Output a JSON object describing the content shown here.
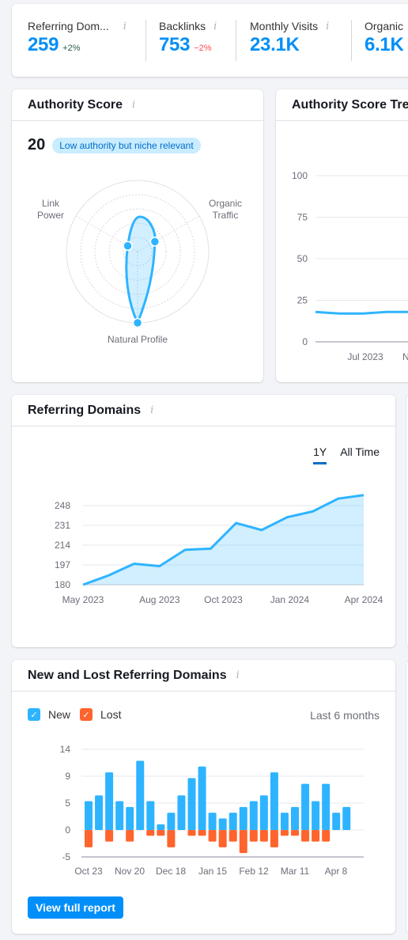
{
  "metrics": [
    {
      "label": "Referring Dom...",
      "value": "259",
      "delta": "+2%",
      "delta_type": "positive"
    },
    {
      "label": "Backlinks",
      "value": "753",
      "delta": "−2%",
      "delta_type": "negative"
    },
    {
      "label": "Monthly Visits",
      "value": "23.1K",
      "delta": "",
      "delta_type": ""
    },
    {
      "label": "Organic",
      "value": "6.1K",
      "delta": "",
      "delta_type": ""
    }
  ],
  "icons": {
    "info": "i"
  },
  "authority_score": {
    "title": "Authority Score",
    "score": "20",
    "badge": "Low authority but niche relevant",
    "radar": {
      "axes": [
        {
          "label_lines": [
            "Link",
            "Power"
          ],
          "value": 0.16
        },
        {
          "label_lines": [
            "Organic",
            "Traffic"
          ],
          "value": 0.28
        },
        {
          "label_lines": [
            "Natural Profile"
          ],
          "value": 1.0
        }
      ],
      "rings": 5
    }
  },
  "authority_trend": {
    "title": "Authority Score Trend",
    "yticks": [
      "100",
      "75",
      "50",
      "25",
      "0"
    ],
    "xticks": [
      "Jul 2023",
      "N"
    ],
    "values": [
      18,
      17,
      17,
      18,
      18,
      18
    ]
  },
  "referring_domains": {
    "title": "Referring Domains",
    "tabs": [
      {
        "label": "1Y",
        "active": true
      },
      {
        "label": "All Time",
        "active": false
      }
    ],
    "chart_data": {
      "type": "area",
      "x": [
        "May 2023",
        "Jun 2023",
        "Jul 2023",
        "Aug 2023",
        "Sep 2023",
        "Oct 2023",
        "Nov 2023",
        "Dec 2023",
        "Jan 2024",
        "Feb 2024",
        "Mar 2024",
        "Apr 2024"
      ],
      "values": [
        180,
        188,
        198,
        196,
        210,
        211,
        233,
        227,
        238,
        243,
        254,
        257
      ],
      "yticks": [
        180,
        197,
        214,
        231,
        248
      ],
      "xtick_labels": [
        "May 2023",
        "Aug 2023",
        "Oct 2023",
        "Jan 2024",
        "Apr 2024"
      ],
      "ylim": [
        180,
        260
      ],
      "color": "#2eb4ff"
    }
  },
  "new_lost": {
    "title": "New and Lost Referring Domains",
    "legend": [
      {
        "label": "New",
        "color": "#2eb4ff"
      },
      {
        "label": "Lost",
        "color": "#ff642d"
      }
    ],
    "period": "Last 6 months",
    "button": "View full report",
    "chart_data": {
      "type": "bar",
      "series": [
        {
          "name": "New",
          "values": [
            5,
            6,
            10,
            5,
            4,
            12,
            5,
            1,
            3,
            6,
            9,
            11,
            3,
            2,
            3,
            4,
            5,
            6,
            10,
            3,
            4,
            8,
            5,
            8,
            3,
            4
          ]
        },
        {
          "name": "Lost",
          "values": [
            -3,
            0,
            -2,
            0,
            -2,
            0,
            -1,
            -1,
            -3,
            0,
            -1,
            -1,
            -2,
            -3,
            -2,
            -4,
            -2,
            -2,
            -3,
            -1,
            -1,
            -2,
            -2,
            -2,
            0,
            0
          ]
        }
      ],
      "yticks": [
        "14",
        "9",
        "5",
        "0",
        "-5"
      ],
      "ylim": [
        -4.67,
        14
      ],
      "xtick_labels": [
        "Oct 23",
        "Nov 20",
        "Dec 18",
        "Jan 15",
        "Feb 12",
        "Mar 11",
        "Apr 8"
      ]
    }
  }
}
